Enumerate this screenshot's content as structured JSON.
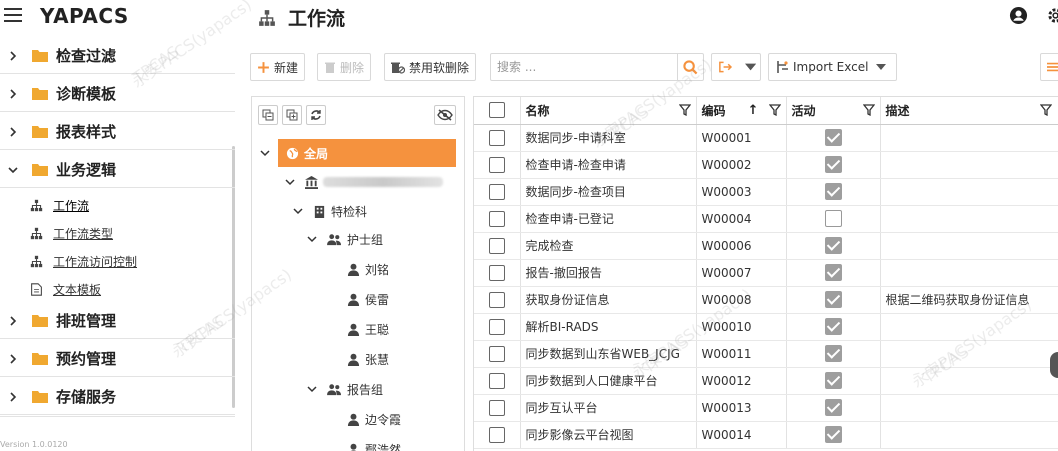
{
  "app": {
    "brand": "YAPACS",
    "page_title": "工作流"
  },
  "sidebar": {
    "items": [
      {
        "label": "检查过滤",
        "expanded": false
      },
      {
        "label": "诊断模板",
        "expanded": false
      },
      {
        "label": "报表样式",
        "expanded": false
      },
      {
        "label": "业务逻辑",
        "expanded": true
      },
      {
        "label": "排班管理",
        "expanded": false
      },
      {
        "label": "预约管理",
        "expanded": false
      },
      {
        "label": "存储服务",
        "expanded": false
      }
    ],
    "sub_items": [
      {
        "label": "工作流",
        "icon": "sitemap-icon",
        "active": true
      },
      {
        "label": "工作流类型",
        "icon": "sitemap-icon",
        "active": false
      },
      {
        "label": "工作流访问控制",
        "icon": "sitemap-icon",
        "active": false
      },
      {
        "label": "文本模板",
        "icon": "file-text-icon",
        "active": false
      }
    ],
    "version": "Version 1.0.0120"
  },
  "toolbar": {
    "new_label": "新建",
    "delete_label": "删除",
    "soft_delete_label": "禁用软删除",
    "search_placeholder": "搜索 ...",
    "import_label": "Import Excel"
  },
  "tree": {
    "root": "全局",
    "dept": "特检科",
    "groups": [
      {
        "label": "护士组",
        "members": [
          "刘铭",
          "侯雷",
          "王聪",
          "张慧"
        ]
      },
      {
        "label": "报告组",
        "members": [
          "边令霞",
          "鄢浩然"
        ]
      }
    ]
  },
  "table": {
    "columns": {
      "name": "名称",
      "code": "编码",
      "active": "活动",
      "desc": "描述"
    },
    "rows": [
      {
        "name": "数据同步-申请科室",
        "code": "W00001",
        "active": true,
        "desc": ""
      },
      {
        "name": "检查申请-检查申请",
        "code": "W00002",
        "active": true,
        "desc": ""
      },
      {
        "name": "数据同步-检查项目",
        "code": "W00003",
        "active": true,
        "desc": ""
      },
      {
        "name": "检查申请-已登记",
        "code": "W00004",
        "active": false,
        "desc": ""
      },
      {
        "name": "完成检查",
        "code": "W00006",
        "active": true,
        "desc": ""
      },
      {
        "name": "报告-撤回报告",
        "code": "W00007",
        "active": true,
        "desc": ""
      },
      {
        "name": "获取身份证信息",
        "code": "W00008",
        "active": true,
        "desc": "根据二维码获取身份证信息"
      },
      {
        "name": "解析BI-RADS",
        "code": "W00010",
        "active": true,
        "desc": ""
      },
      {
        "name": "同步数据到山东省WEB_JCJG",
        "code": "W00011",
        "active": true,
        "desc": ""
      },
      {
        "name": "同步数据到人口健康平台",
        "code": "W00012",
        "active": true,
        "desc": ""
      },
      {
        "name": "同步互认平台",
        "code": "W00013",
        "active": true,
        "desc": ""
      },
      {
        "name": "同步影像云平台视图",
        "code": "W00014",
        "active": true,
        "desc": ""
      }
    ]
  },
  "watermark": {
    "line1": "永安PACS(yapacs)",
    "line2": "TPCAS"
  },
  "colors": {
    "accent": "#f5923e",
    "folder": "#f0a830",
    "check": "#9e9e9e"
  }
}
